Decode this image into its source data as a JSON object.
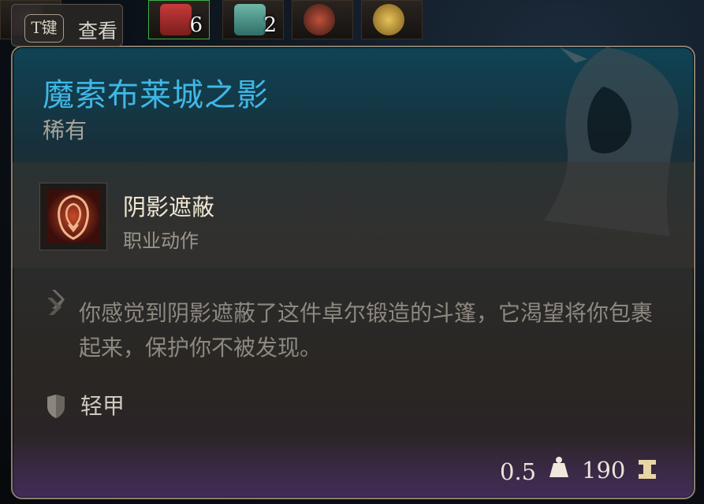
{
  "hint": {
    "key": "T键",
    "label": "查看"
  },
  "inventory": [
    {
      "icon": "potion-icon",
      "count": ""
    },
    {
      "icon": "scroll-star-icon",
      "count": "6"
    },
    {
      "icon": "scroll-heart-icon",
      "count": "2"
    },
    {
      "icon": "meat-food-icon",
      "count": ""
    },
    {
      "icon": "gold-pile-icon",
      "count": ""
    }
  ],
  "item": {
    "name": "魔索布莱城之影",
    "rarity": "稀有",
    "action": {
      "name": "阴影遮蔽",
      "type": "职业动作",
      "icon": "shadow-cloak-action-icon"
    },
    "description": "你感觉到阴影遮蔽了这件卓尔锻造的斗篷，它渴望将你包裹起来，保护你不被发现。",
    "armor_type": "轻甲",
    "weight": "0.5",
    "price": "190"
  },
  "colors": {
    "title": "#3fb7e6",
    "rarity": "#a7a39b",
    "action_name": "#efe7d2",
    "description": "#8d8880",
    "footer_text": "#e9e4dc"
  }
}
